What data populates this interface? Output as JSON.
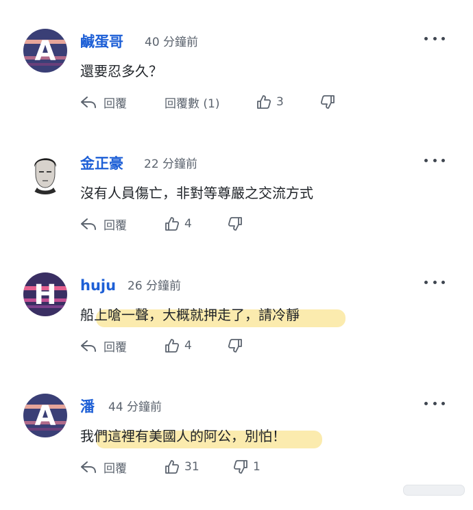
{
  "comments": [
    {
      "avatar": {
        "type": "letter",
        "letter": "A",
        "bg": "#3a3f76",
        "band1": "#e6a59a",
        "band2": "#b06a8a"
      },
      "name": "鹹蛋哥",
      "time": "40 分鐘前",
      "text": "還要忍多久？",
      "highlighted": false,
      "reply_label": "回覆",
      "replies_label": "回覆數 (1)",
      "likes": "3",
      "dislikes": ""
    },
    {
      "avatar": {
        "type": "photo",
        "icon": "person-photo"
      },
      "name": "金正豪",
      "time": "22 分鐘前",
      "text": "沒有人員傷亡，非對等尊嚴之交流方式",
      "highlighted": false,
      "reply_label": "回覆",
      "likes": "4",
      "dislikes": ""
    },
    {
      "avatar": {
        "type": "letter",
        "letter": "H",
        "bg": "#3a2f63",
        "band1": "#e4618f",
        "band2": "#c14f93"
      },
      "name": "huju",
      "time": "26 分鐘前",
      "text": "船上嗆一聲，大概就押走了，請冷靜",
      "highlighted": true,
      "reply_label": "回覆",
      "likes": "4",
      "dislikes": ""
    },
    {
      "avatar": {
        "type": "letter",
        "letter": "A",
        "bg": "#3a3f76",
        "band1": "#e6a59a",
        "band2": "#b06a8a"
      },
      "name": "潘",
      "time": "44 分鐘前",
      "text": "我們這裡有美國人的阿公，別怕！",
      "highlighted": true,
      "reply_label": "回覆",
      "likes": "31",
      "dislikes": "1"
    }
  ],
  "colors": {
    "name": "#1d5fd6",
    "meta": "#5b636e",
    "highlight": "#fbe9a5"
  }
}
